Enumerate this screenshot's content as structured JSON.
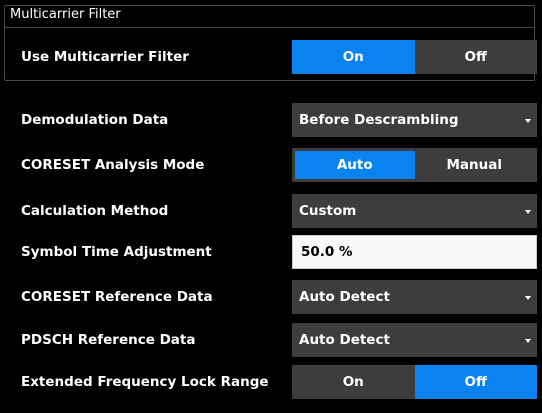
{
  "group": {
    "title": "Multicarrier Filter"
  },
  "colors": {
    "accent": "#0a82f0",
    "control_bg": "#3d3d3d",
    "panel_bg": "#000000"
  },
  "rows": {
    "multicarrier": {
      "label": "Use Multicarrier Filter",
      "on": "On",
      "off": "Off",
      "selected": "On"
    },
    "demod_data": {
      "label": "Demodulation Data",
      "value": "Before Descrambling"
    },
    "coreset_mode": {
      "label": "CORESET Analysis Mode",
      "auto": "Auto",
      "manual": "Manual",
      "selected": "Auto"
    },
    "calc_method": {
      "label": "Calculation Method",
      "value": "Custom"
    },
    "symbol_time": {
      "label": "Symbol Time Adjustment",
      "value": "50.0 %"
    },
    "coreset_ref": {
      "label": "CORESET Reference Data",
      "value": "Auto Detect"
    },
    "pdsch_ref": {
      "label": "PDSCH Reference Data",
      "value": "Auto Detect"
    },
    "ext_freq_lock": {
      "label": "Extended Frequency Lock Range",
      "on": "On",
      "off": "Off",
      "selected": "Off"
    }
  }
}
